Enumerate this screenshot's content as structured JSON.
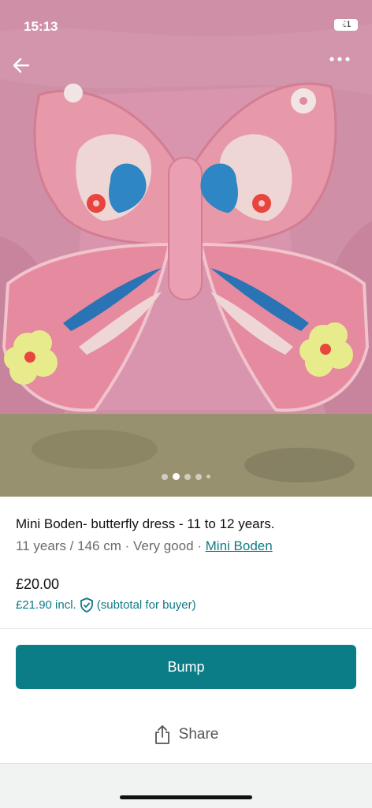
{
  "status_bar": {
    "time": "15:13",
    "battery": "21"
  },
  "listing": {
    "title": "Mini Boden- butterfly dress - 11 to 12 years.",
    "size_condition": "11 years / 146 cm · Very good · ",
    "brand": "Mini Boden",
    "price": "£20.00",
    "price_incl": "£21.90 incl.",
    "buyer_note": "(subtotal for buyer)"
  },
  "gallery": {
    "image_count": 5,
    "active_index": 1
  },
  "actions": {
    "bump_label": "Bump",
    "share_label": "Share"
  },
  "colors": {
    "accent": "#0b7d87",
    "link": "#0f7a84"
  }
}
